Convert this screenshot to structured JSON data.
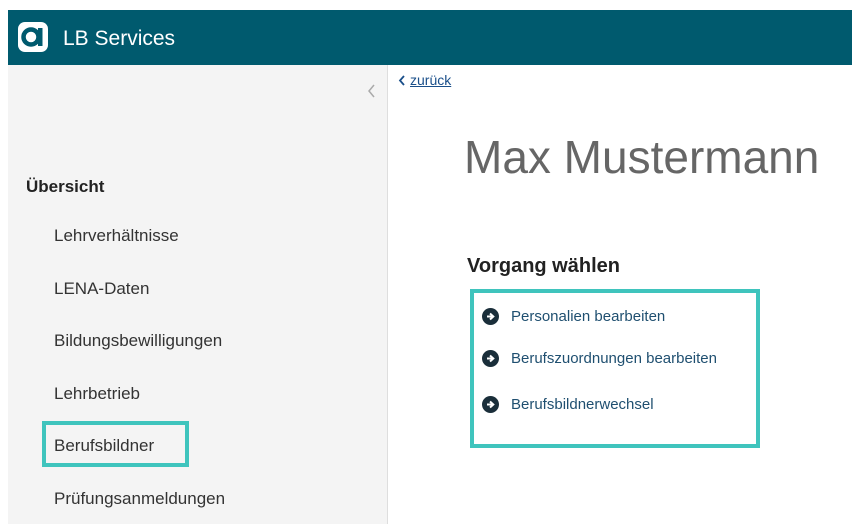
{
  "header": {
    "title": "LB Services",
    "logo_icon": "lb-logo-icon"
  },
  "sidebar": {
    "collapse_icon": "chevron-left-icon",
    "overview_label": "Übersicht",
    "items": [
      {
        "label": "Lehrverhältnisse"
      },
      {
        "label": "LENA-Daten"
      },
      {
        "label": "Bildungsbewilligungen"
      },
      {
        "label": "Lehrbetrieb"
      },
      {
        "label": "Berufsbildner",
        "highlighted": true
      },
      {
        "label": "Prüfungsanmeldungen"
      }
    ]
  },
  "main": {
    "back_label": "zurück",
    "person_name": "Max Mustermann",
    "section_title": "Vorgang wählen",
    "actions": [
      {
        "label": "Personalien bearbeiten",
        "icon": "arrow-circle-right-icon"
      },
      {
        "label": "Berufszuordnungen bearbeiten",
        "icon": "arrow-circle-right-icon"
      },
      {
        "label": "Berufsbildnerwechsel",
        "icon": "arrow-circle-right-icon"
      }
    ]
  },
  "colors": {
    "header_bg": "#005a6e",
    "highlight": "#3fc4bd",
    "link": "#1f4f70"
  }
}
